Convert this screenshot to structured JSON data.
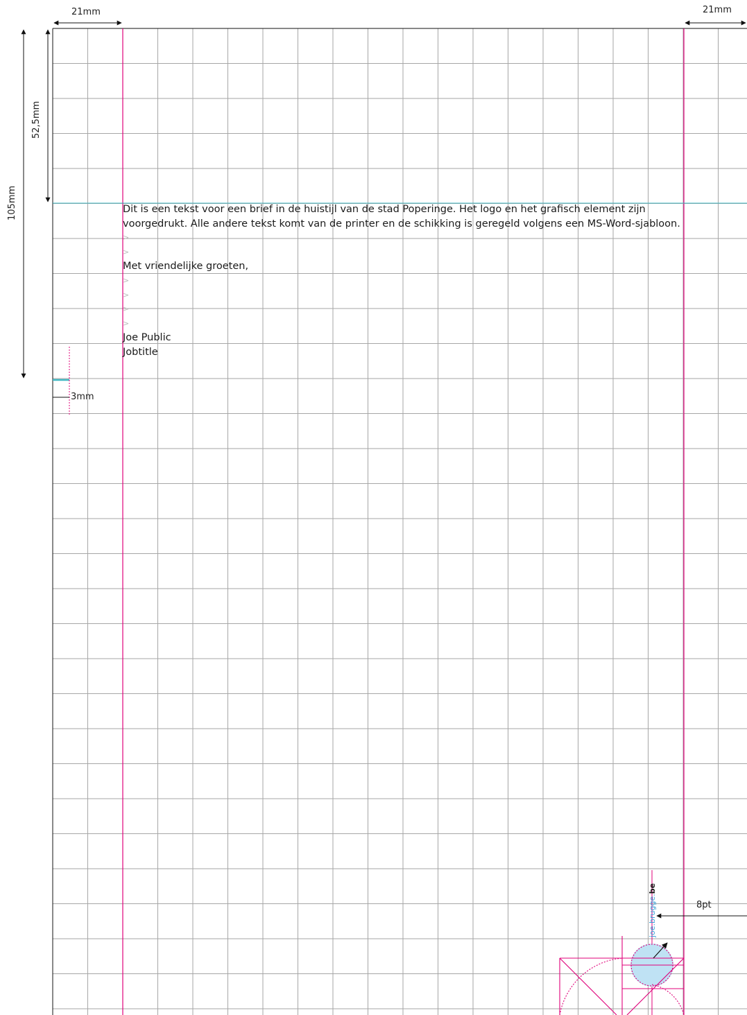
{
  "dimensions": {
    "margin_left": "21mm",
    "margin_right": "21mm",
    "header_height": "52,5mm",
    "fold_height": "105mm",
    "fold_mark": "3mm",
    "url_offset": "8pt"
  },
  "letter": {
    "body": "Dit is een tekst voor een brief in de huistijl van de stad Poperinge. Het logo en het grafisch element zijn voorgedrukt. Alle andere tekst komt van de printer en de schikking is geregeld volgens een MS-Word-sjabloon.",
    "closing": "Met vriendelijke groeten,",
    "name": "Joe Public",
    "jobtitle": "Jobtitle",
    "paragraph_mark": ">"
  },
  "url": {
    "main": "joe.brugge.",
    "tld": "be"
  },
  "colors": {
    "grid": "#a6a6a6",
    "guide_magenta": "#e0007a",
    "guide_cyan": "#3fb7c2",
    "logo_circle": "#bfe2f4",
    "url_blue": "#3aa0d8"
  }
}
